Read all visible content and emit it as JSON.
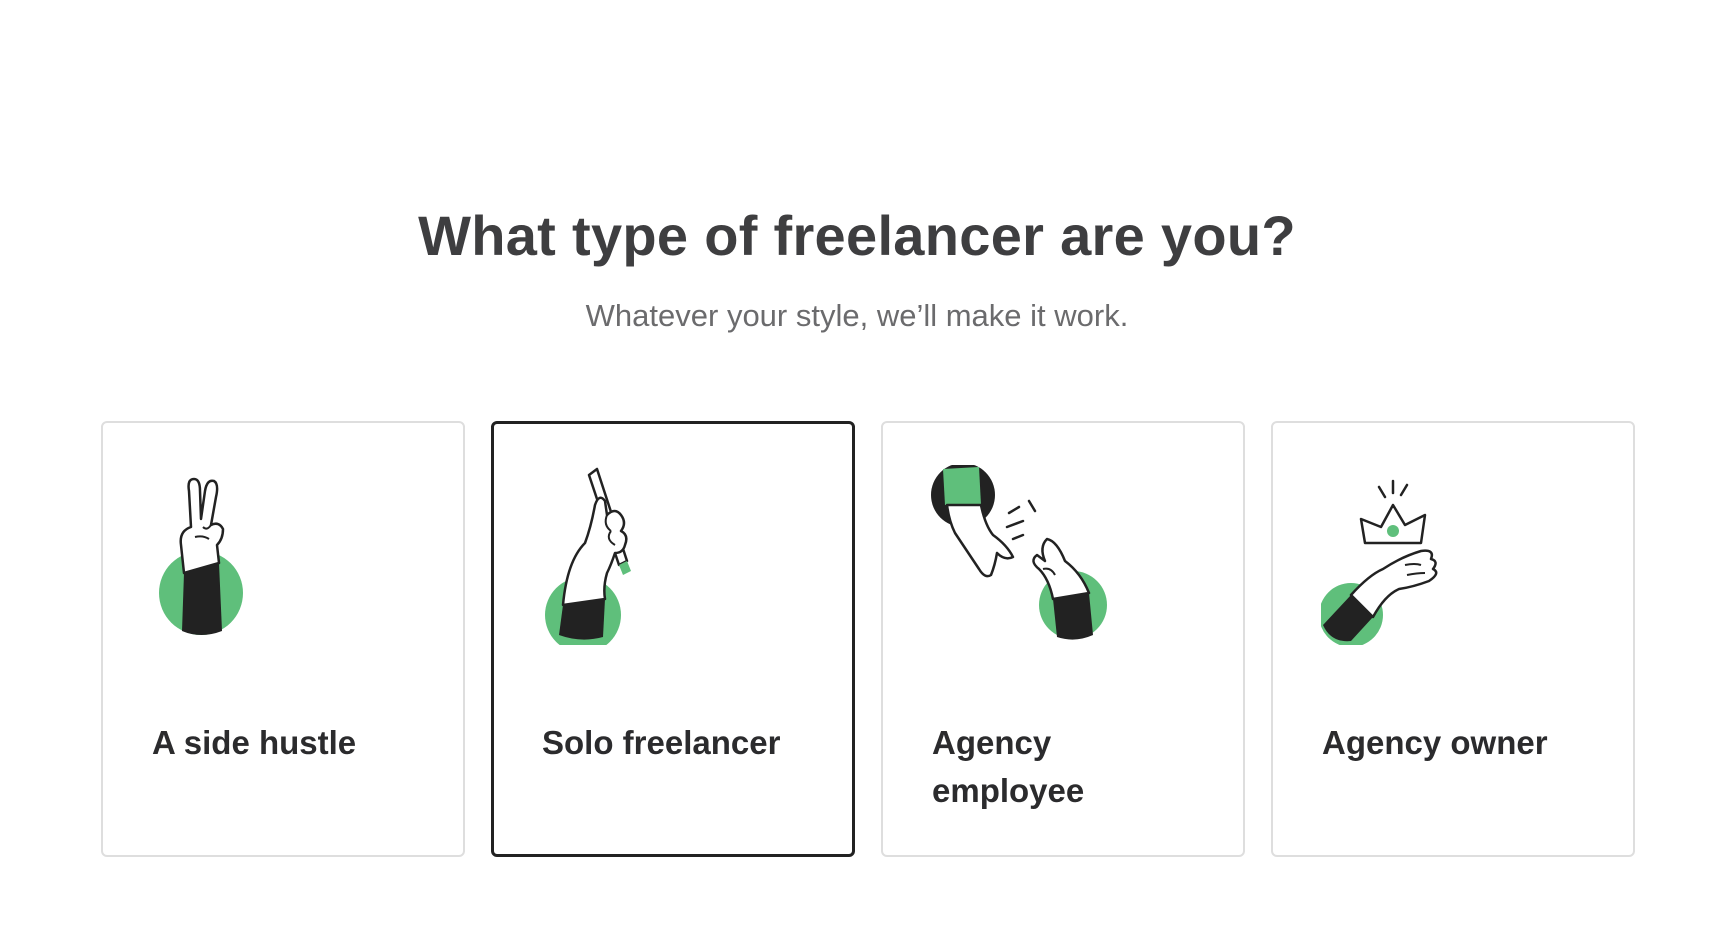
{
  "page": {
    "title": "What type of freelancer are you?",
    "subtitle": "Whatever your style, we’ll make it work."
  },
  "colors": {
    "accent_green": "#5fbf7b",
    "ink": "#222222",
    "card_border": "#dedede"
  },
  "options": [
    {
      "label": "A side hustle",
      "icon": "peace-sign-hand-icon",
      "selected": false
    },
    {
      "label": "Solo freelancer",
      "icon": "hand-holding-pencil-icon",
      "selected": true
    },
    {
      "label": "Agency employee",
      "icon": "hands-passing-icon",
      "selected": false
    },
    {
      "label": "Agency owner",
      "icon": "hand-with-crown-icon",
      "selected": false
    }
  ]
}
